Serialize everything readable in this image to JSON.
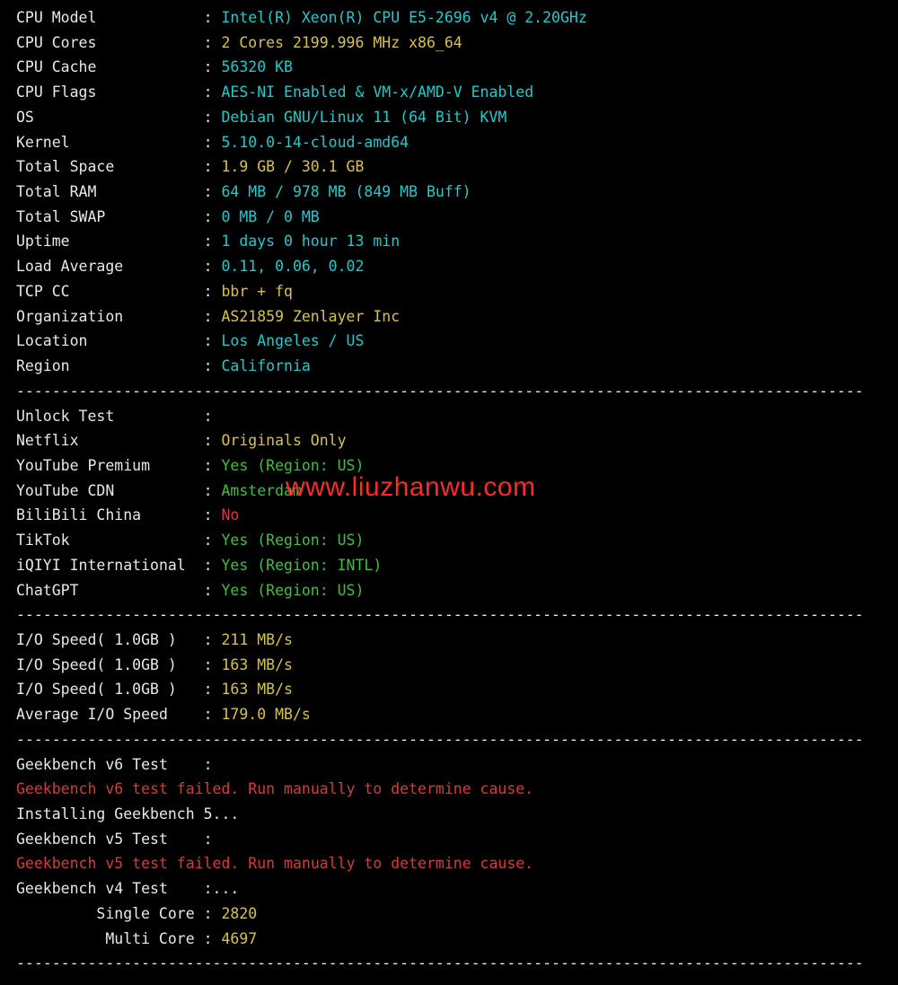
{
  "watermark": "www.liuzhanwu.com",
  "hr_line": "-----------------------------------------------------------------------------------------------",
  "sysinfo": [
    {
      "label": "CPU Model",
      "sep": ": ",
      "value": "Intel(R) Xeon(R) CPU E5-2696 v4 @ 2.20GHz",
      "color": "cyan"
    },
    {
      "label": "CPU Cores",
      "sep": ": ",
      "value": "2 Cores 2199.996 MHz x86_64",
      "color": "yellow"
    },
    {
      "label": "CPU Cache",
      "sep": ": ",
      "value": "56320 KB",
      "color": "cyan"
    },
    {
      "label": "CPU Flags",
      "sep": ": ",
      "value": "AES-NI Enabled & VM-x/AMD-V Enabled",
      "color": "cyan"
    },
    {
      "label": "OS",
      "sep": ": ",
      "value": "Debian GNU/Linux 11 (64 Bit) KVM",
      "color": "cyan"
    },
    {
      "label": "Kernel",
      "sep": ": ",
      "value": "5.10.0-14-cloud-amd64",
      "color": "cyan"
    },
    {
      "label": "Total Space",
      "sep": ": ",
      "value": "1.9 GB / 30.1 GB",
      "color": "yellow"
    },
    {
      "label": "Total RAM",
      "sep": ": ",
      "value": "64 MB / 978 MB (849 MB Buff)",
      "color": "cyan"
    },
    {
      "label": "Total SWAP",
      "sep": ": ",
      "value": "0 MB / 0 MB",
      "color": "cyan"
    },
    {
      "label": "Uptime",
      "sep": ": ",
      "value": "1 days 0 hour 13 min",
      "color": "cyan"
    },
    {
      "label": "Load Average",
      "sep": ": ",
      "value": "0.11, 0.06, 0.02",
      "color": "cyan"
    },
    {
      "label": "TCP CC",
      "sep": ": ",
      "value": "bbr + fq",
      "color": "yellow"
    },
    {
      "label": "Organization",
      "sep": ": ",
      "value": "AS21859 Zenlayer Inc",
      "color": "yellow"
    },
    {
      "label": "Location",
      "sep": ": ",
      "value": "Los Angeles / US",
      "color": "cyan"
    },
    {
      "label": "Region",
      "sep": ": ",
      "value": "California",
      "color": "cyan"
    }
  ],
  "unlock_header": {
    "label": "Unlock Test",
    "sep": ":"
  },
  "unlock": [
    {
      "label": "Netflix",
      "sep": ": ",
      "value": "Originals Only",
      "color": "yellow"
    },
    {
      "label": "YouTube Premium",
      "sep": ": ",
      "value": "Yes (Region: US)",
      "color": "green"
    },
    {
      "label": "YouTube CDN",
      "sep": ": ",
      "value": "Amsterdam",
      "color": "green"
    },
    {
      "label": "BiliBili China",
      "sep": ": ",
      "value": "No",
      "color": "red"
    },
    {
      "label": "TikTok",
      "sep": ": ",
      "value": "Yes (Region: US)",
      "color": "green"
    },
    {
      "label": "iQIYI International",
      "sep": ": ",
      "value": "Yes (Region: INTL)",
      "color": "green"
    },
    {
      "label": "ChatGPT",
      "sep": ": ",
      "value": "Yes (Region: US)",
      "color": "green"
    }
  ],
  "iospeed": [
    {
      "label": "I/O Speed( 1.0GB )",
      "sep": ": ",
      "value": "211 MB/s",
      "color": "yellow"
    },
    {
      "label": "I/O Speed( 1.0GB )",
      "sep": ": ",
      "value": "163 MB/s",
      "color": "yellow"
    },
    {
      "label": "I/O Speed( 1.0GB )",
      "sep": ": ",
      "value": "163 MB/s",
      "color": "yellow"
    },
    {
      "label": "Average I/O Speed",
      "sep": ": ",
      "value": "179.0 MB/s",
      "color": "yellow"
    }
  ],
  "geekbench": [
    {
      "label": "Geekbench v6 Test",
      "sep": ":",
      "value": "",
      "color": "white",
      "lblcolor": "white"
    },
    {
      "label": "",
      "sep": "",
      "value": "Geekbench v6 test failed. Run manually to determine cause.",
      "color": "red",
      "full": true
    },
    {
      "label": "",
      "sep": "",
      "value": "Installing Geekbench 5...",
      "color": "white",
      "full": true
    },
    {
      "label": "Geekbench v5 Test",
      "sep": ":",
      "value": "",
      "color": "white",
      "lblcolor": "white"
    },
    {
      "label": "",
      "sep": "",
      "value": "Geekbench v5 test failed. Run manually to determine cause.",
      "color": "red",
      "full": true
    },
    {
      "label": "Geekbench v4 Test",
      "sep": ":...",
      "value": "",
      "color": "white",
      "lblcolor": "white"
    },
    {
      "label": "Single Core",
      "sep": ": ",
      "value": "2820",
      "color": "yellow",
      "indent": true
    },
    {
      "label": "Multi Core",
      "sep": ": ",
      "value": "4697",
      "color": "yellow",
      "indent": true
    }
  ]
}
